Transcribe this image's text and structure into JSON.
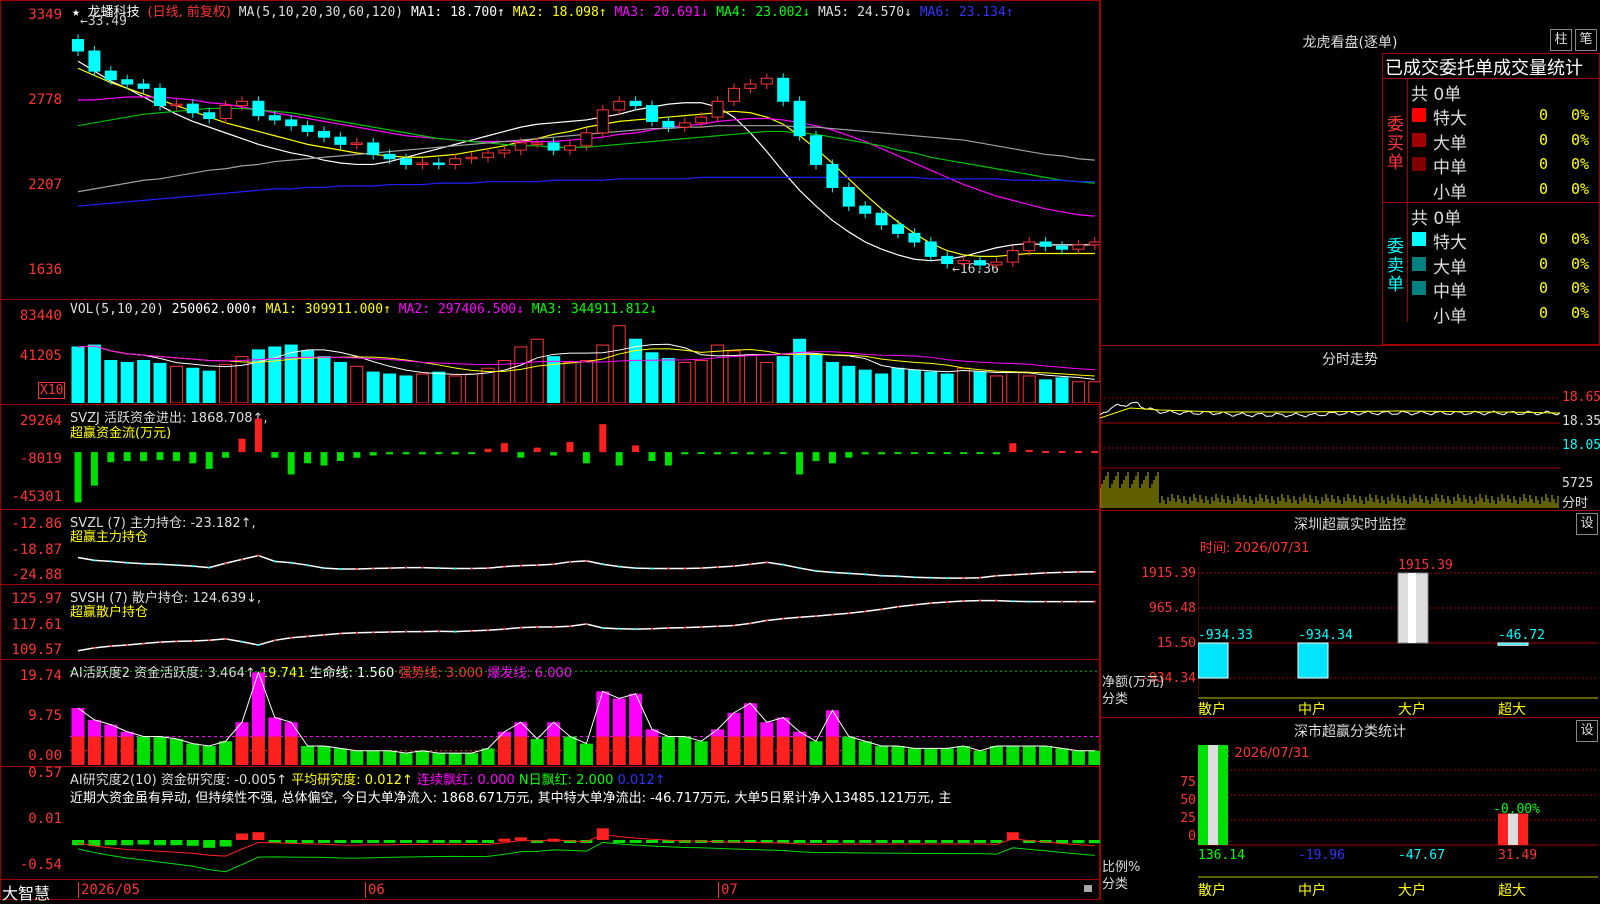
{
  "chart_data": [
    {
      "type": "candlestick",
      "title": "龙蟠科技",
      "period_label": "(日线, 前复权)",
      "ma_label": "MA(5,10,20,30,60,120)",
      "ma_values": [
        "MA1: 18.700↑",
        "MA2: 18.098↑",
        "MA3: 20.691↓",
        "MA4: 23.002↓",
        "MA5: 24.570↓",
        "MA6: 23.134↑"
      ],
      "yticks": [
        "3349",
        "2778",
        "2207",
        "1636"
      ],
      "annotations": [
        "←33.49",
        "←16.36"
      ],
      "close": [
        32.2,
        30.8,
        30.2,
        29.9,
        29.6,
        28.4,
        28.5,
        27.9,
        27.5,
        28.4,
        28.7,
        27.7,
        27.4,
        27.0,
        26.6,
        26.2,
        25.7,
        25.8,
        25.0,
        24.7,
        24.3,
        24.4,
        24.3,
        24.7,
        24.8,
        25.1,
        25.3,
        25.8,
        25.8,
        25.3,
        25.6,
        26.5,
        28.1,
        28.7,
        28.4,
        27.3,
        26.9,
        27.2,
        27.6,
        28.7,
        29.6,
        29.9,
        30.3,
        28.7,
        26.3,
        24.3,
        22.7,
        21.4,
        20.9,
        20.1,
        19.5,
        18.9,
        17.9,
        17.4,
        17.6,
        17.3,
        17.5,
        18.3,
        18.9,
        18.6,
        18.4,
        18.7,
        18.9
      ],
      "ma_lines": {
        "MA1": [
          31.5,
          30.8,
          30.1,
          29.6,
          29.0,
          28.4,
          27.8,
          27.3,
          26.9,
          26.5,
          26.1,
          25.7,
          25.4,
          25.1,
          24.9,
          24.6,
          24.4,
          24.3,
          24.3,
          24.5,
          24.8,
          25.1,
          25.4,
          25.7,
          26.0,
          26.3,
          26.6,
          26.9,
          27.1,
          27.2,
          27.3,
          27.4,
          27.6,
          27.8,
          28.1,
          28.3,
          28.5,
          28.6,
          28.6,
          28.3,
          27.6,
          26.5,
          25.2,
          23.8,
          22.5,
          21.4,
          20.4,
          19.6,
          18.9,
          18.4,
          18.0,
          17.7,
          17.6,
          17.7,
          17.9,
          18.2,
          18.5,
          18.7,
          18.8,
          18.7,
          18.7,
          18.7,
          18.7
        ],
        "MA2": [
          31.0,
          30.5,
          30.0,
          29.6,
          29.2,
          28.8,
          28.4,
          28.0,
          27.6,
          27.2,
          26.9,
          26.6,
          26.3,
          26.0,
          25.7,
          25.5,
          25.3,
          25.1,
          25.0,
          24.9,
          24.8,
          24.8,
          24.9,
          25.0,
          25.2,
          25.4,
          25.6,
          25.9,
          26.1,
          26.4,
          26.6,
          26.9,
          27.1,
          27.3,
          27.4,
          27.5,
          27.6,
          27.7,
          27.8,
          27.9,
          28.0,
          27.9,
          27.6,
          27.1,
          26.3,
          25.4,
          24.4,
          23.3,
          22.2,
          21.2,
          20.3,
          19.5,
          18.8,
          18.3,
          18.0,
          17.9,
          17.9,
          18.0,
          18.1,
          18.1,
          18.1,
          18.1,
          18.1
        ],
        "MA3": [
          28.8,
          28.8,
          28.9,
          29.0,
          29.0,
          29.0,
          28.9,
          28.8,
          28.6,
          28.5,
          28.3,
          28.1,
          27.9,
          27.7,
          27.5,
          27.3,
          27.1,
          26.9,
          26.7,
          26.5,
          26.3,
          26.2,
          26.1,
          26.0,
          25.9,
          25.9,
          25.9,
          25.9,
          25.9,
          25.9,
          26.0,
          26.1,
          26.2,
          26.4,
          26.5,
          26.7,
          26.9,
          27.0,
          27.1,
          27.3,
          27.4,
          27.5,
          27.5,
          27.4,
          27.2,
          27.0,
          26.7,
          26.3,
          25.9,
          25.4,
          24.9,
          24.4,
          23.9,
          23.4,
          22.9,
          22.5,
          22.1,
          21.8,
          21.5,
          21.2,
          21.0,
          20.8,
          20.7
        ],
        "MA4": [
          27.0,
          27.2,
          27.4,
          27.6,
          27.8,
          27.9,
          28.0,
          28.1,
          28.2,
          28.2,
          28.2,
          28.1,
          28.0,
          27.9,
          27.7,
          27.5,
          27.3,
          27.1,
          26.9,
          26.7,
          26.5,
          26.3,
          26.1,
          26.0,
          25.9,
          25.8,
          25.7,
          25.6,
          25.6,
          25.5,
          25.5,
          25.5,
          25.6,
          25.7,
          25.8,
          25.9,
          26.0,
          26.1,
          26.2,
          26.3,
          26.4,
          26.5,
          26.6,
          26.6,
          26.5,
          26.4,
          26.2,
          26.0,
          25.8,
          25.6,
          25.3,
          25.1,
          24.8,
          24.6,
          24.4,
          24.2,
          24.0,
          23.8,
          23.6,
          23.4,
          23.2,
          23.1,
          23.0
        ],
        "MA5": [
          22.4,
          22.6,
          22.8,
          23.0,
          23.2,
          23.3,
          23.5,
          23.7,
          23.9,
          24.0,
          24.2,
          24.3,
          24.5,
          24.6,
          24.7,
          24.8,
          24.9,
          25.0,
          25.1,
          25.2,
          25.3,
          25.4,
          25.5,
          25.6,
          25.7,
          25.8,
          25.9,
          26.0,
          26.1,
          26.2,
          26.3,
          26.4,
          26.5,
          26.6,
          26.7,
          26.8,
          26.8,
          26.9,
          26.9,
          27.0,
          27.0,
          27.0,
          27.0,
          27.0,
          26.9,
          26.9,
          26.8,
          26.7,
          26.6,
          26.5,
          26.4,
          26.3,
          26.2,
          26.1,
          26.0,
          25.8,
          25.6,
          25.4,
          25.2,
          25.0,
          24.9,
          24.7,
          24.6
        ],
        "MA6": [
          21.4,
          21.5,
          21.6,
          21.7,
          21.8,
          21.9,
          22.0,
          22.1,
          22.2,
          22.3,
          22.4,
          22.5,
          22.6,
          22.6,
          22.7,
          22.7,
          22.8,
          22.8,
          22.8,
          22.9,
          22.9,
          22.9,
          23.0,
          23.0,
          23.0,
          23.1,
          23.1,
          23.1,
          23.1,
          23.2,
          23.2,
          23.2,
          23.2,
          23.3,
          23.3,
          23.3,
          23.3,
          23.3,
          23.4,
          23.4,
          23.4,
          23.4,
          23.4,
          23.4,
          23.4,
          23.4,
          23.4,
          23.4,
          23.4,
          23.4,
          23.4,
          23.4,
          23.3,
          23.3,
          23.3,
          23.3,
          23.3,
          23.2,
          23.2,
          23.2,
          23.2,
          23.1,
          23.1
        ]
      },
      "ylim": [
        15.0,
        34.5
      ],
      "x_labels": [
        "2026/05",
        "06",
        "07"
      ]
    },
    {
      "type": "bar",
      "title": "VOL(5,10,20)",
      "values_text": [
        "250062.000↑",
        "MA1: 309911.000↑",
        "MA2: 297406.500↓",
        "MA3: 344911.812↓"
      ],
      "yticks": [
        "83440",
        "41205"
      ],
      "unit": "X10",
      "values": [
        58,
        60,
        44,
        42,
        44,
        41,
        38,
        36,
        33,
        40,
        48,
        55,
        58,
        60,
        54,
        48,
        42,
        38,
        32,
        30,
        28,
        30,
        32,
        28,
        30,
        36,
        44,
        58,
        66,
        48,
        42,
        44,
        60,
        80,
        66,
        52,
        46,
        42,
        44,
        60,
        54,
        50,
        42,
        48,
        66,
        50,
        42,
        38,
        34,
        30,
        36,
        34,
        32,
        30,
        36,
        32,
        28,
        32,
        28,
        24,
        26,
        22,
        22
      ],
      "ylim": [
        0,
        88
      ]
    },
    {
      "type": "bar",
      "title": "SVZJ 活跃资金进出: 1868.708↑,",
      "subtitle": "超赢资金流(万元)",
      "yticks": [
        "29264",
        "-8019",
        "-45301"
      ],
      "values": [
        -45,
        -30,
        -9,
        -8,
        -8,
        -7,
        -8,
        -10,
        -15,
        -5,
        12,
        30,
        -5,
        -20,
        -10,
        -12,
        -8,
        -5,
        -3,
        -2,
        -2,
        -2,
        -1,
        -2,
        -1,
        3,
        8,
        -5,
        4,
        -3,
        9,
        -10,
        25,
        -12,
        6,
        -8,
        -12,
        -2,
        -1,
        -2,
        -1,
        -2,
        -2,
        -1,
        -20,
        -8,
        -10,
        -5,
        -2,
        -2,
        -1,
        -1,
        -1,
        -1,
        -1,
        -1,
        -2,
        8,
        2,
        1,
        1,
        1,
        1
      ],
      "ylim": [
        -50,
        35
      ]
    },
    {
      "type": "line",
      "title": "SVZL (7) 主力持仓: -23.182↑,",
      "subtitle": "超赢主力持仓",
      "yticks": [
        "-12.86",
        "-18.87",
        "-24.88"
      ],
      "values": [
        -20.2,
        -20.8,
        -21.0,
        -21.3,
        -21.5,
        -21.6,
        -21.8,
        -22.0,
        -22.3,
        -21.4,
        -20.6,
        -19.8,
        -21.0,
        -21.3,
        -21.8,
        -22.4,
        -22.6,
        -22.6,
        -22.5,
        -22.4,
        -22.3,
        -22.3,
        -22.4,
        -22.5,
        -22.5,
        -22.4,
        -22.1,
        -21.9,
        -21.8,
        -21.6,
        -21.1,
        -20.9,
        -21.6,
        -22.1,
        -22.4,
        -22.5,
        -22.5,
        -22.5,
        -22.4,
        -22.2,
        -22.0,
        -21.6,
        -21.2,
        -21.7,
        -22.4,
        -23.0,
        -23.3,
        -23.5,
        -23.7,
        -24.0,
        -24.1,
        -24.3,
        -24.4,
        -24.5,
        -24.5,
        -24.4,
        -24.0,
        -23.8,
        -23.6,
        -23.4,
        -23.3,
        -23.2,
        -23.2
      ],
      "ylim": [
        -25.5,
        -12.0
      ]
    },
    {
      "type": "line",
      "title": "SVSH (7) 散户持仓: 124.639↓,",
      "subtitle": "超赢散户持仓",
      "yticks": [
        "125.97",
        "117.61",
        "109.57"
      ],
      "values": [
        111.0,
        111.8,
        112.3,
        112.6,
        113.0,
        113.4,
        113.6,
        113.7,
        113.9,
        114.3,
        113.5,
        112.6,
        113.9,
        114.6,
        115.0,
        115.4,
        115.8,
        116.0,
        116.1,
        116.2,
        116.3,
        116.3,
        116.4,
        116.3,
        116.5,
        116.7,
        117.0,
        117.4,
        117.6,
        117.6,
        117.8,
        118.4,
        117.3,
        117.1,
        117.0,
        117.1,
        117.3,
        117.4,
        117.6,
        117.8,
        118.0,
        118.6,
        119.4,
        119.9,
        120.3,
        120.6,
        121.0,
        121.4,
        121.9,
        122.5,
        123.2,
        123.7,
        124.2,
        124.5,
        124.8,
        124.9,
        124.9,
        124.7,
        124.6,
        124.6,
        124.6,
        124.6,
        124.6
      ],
      "ylim": [
        109.0,
        127.0
      ]
    },
    {
      "type": "bar",
      "title": "AI活跃度2 资金活跃度: 3.464↑",
      "values_text": [
        "19.741",
        "生命线: 1.560",
        "强势线: 3.000",
        "爆发线: 6.000"
      ],
      "yticks": [
        "19.74",
        "9.75",
        "0.00"
      ],
      "values": [
        12,
        9.5,
        8.5,
        7,
        6,
        6,
        5.5,
        4.5,
        4,
        5,
        9,
        19.5,
        10,
        9,
        4,
        4,
        3.5,
        3,
        3,
        3,
        2.5,
        3,
        2.5,
        2.5,
        2.5,
        3.5,
        7,
        9,
        5.5,
        9,
        6,
        4.5,
        15.5,
        14,
        15,
        7.5,
        6,
        6,
        5,
        7.5,
        11,
        13,
        9,
        10,
        7,
        5,
        11.5,
        6,
        5,
        4,
        4,
        3.5,
        3.5,
        3.5,
        4,
        3,
        4,
        4,
        4,
        4,
        3.5,
        3,
        3
      ],
      "ylim": [
        0,
        20
      ]
    },
    {
      "type": "bar",
      "title": "AI研究度2(10) 资金研究度: -0.005↑",
      "values_text": [
        "平均研究度: 0.012↑",
        "连续飘红: 0.000",
        "N日飘红: 2.000",
        "0.012↑"
      ],
      "comment": "近期大资金虽有异动, 但持续性不强, 总体偏空, 今日大单净流入: 1868.671万元, 其中特大单净流出: -46.717万元, 大单5日累计净入13485.121万元, 主",
      "yticks": [
        "0.57",
        "0.01",
        "-0.54"
      ],
      "values": [
        -0.08,
        -0.09,
        -0.08,
        -0.08,
        -0.07,
        -0.08,
        -0.08,
        -0.09,
        -0.12,
        -0.1,
        0.1,
        0.12,
        -0.02,
        -0.03,
        -0.03,
        -0.03,
        -0.04,
        -0.03,
        -0.02,
        -0.02,
        -0.02,
        -0.02,
        -0.02,
        -0.02,
        -0.03,
        -0.02,
        0.02,
        0.04,
        -0.01,
        0.02,
        -0.02,
        -0.03,
        0.18,
        -0.03,
        -0.02,
        -0.02,
        -0.02,
        -0.02,
        -0.01,
        -0.02,
        -0.02,
        -0.02,
        -0.02,
        -0.02,
        -0.04,
        -0.03,
        -0.02,
        -0.02,
        -0.02,
        -0.02,
        -0.02,
        -0.02,
        -0.02,
        -0.02,
        -0.02,
        -0.02,
        -0.03,
        0.12,
        -0.04,
        -0.04,
        -0.05,
        -0.05,
        -0.05
      ],
      "ylim": [
        -0.6,
        0.6
      ]
    }
  ],
  "footer": {
    "brand": "大智慧"
  },
  "right_panel": {
    "dragon_tiger": {
      "title": "龙虎看盘(逐单)",
      "btn_zhu": "柱",
      "btn_bi": "笔",
      "subtitle": "已成交委托单成交量统计",
      "buy_label": "委买单",
      "sell_label": "委卖单",
      "buy_total": "共 0单",
      "sell_total": "共 0单",
      "buy_rows": [
        {
          "label": "特大",
          "count": "0",
          "pct": "0%",
          "color": "#ff0000"
        },
        {
          "label": "大单",
          "count": "0",
          "pct": "0%",
          "color": "#a00000"
        },
        {
          "label": "中单",
          "count": "0",
          "pct": "0%",
          "color": "#800000"
        },
        {
          "label": "小单",
          "count": "0",
          "pct": "0%",
          "color": ""
        }
      ],
      "sell_rows": [
        {
          "label": "特大",
          "count": "0",
          "pct": "0%",
          "color": "#00ffff"
        },
        {
          "label": "大单",
          "count": "0",
          "pct": "0%",
          "color": "#008080"
        },
        {
          "label": "中单",
          "count": "0",
          "pct": "0%",
          "color": "#008080"
        },
        {
          "label": "小单",
          "count": "0",
          "pct": "0%",
          "color": ""
        }
      ]
    },
    "intraday": {
      "title": "分时走势",
      "price_labels": [
        "18.65",
        "18.35",
        "18.05"
      ],
      "vol_label": "5725",
      "vol_unit": "分时"
    },
    "sz_monitor": {
      "title": "深圳超赢实时监控",
      "btn": "设",
      "time": "时间: 2026/07/31",
      "yticks": [
        "1915.39",
        "965.48",
        "15.50",
        "-934.34"
      ],
      "ylabel": "净额(万元)",
      "xlabel": "分类",
      "categories": [
        "散户",
        "中户",
        "大户",
        "超大"
      ],
      "values": [
        -934.34,
        -934.34,
        1915.39,
        -46.72
      ],
      "value_labels": [
        "-934.33",
        "-934.34",
        "1915.39",
        "-46.72"
      ]
    },
    "sz_class": {
      "title": "深市超赢分类统计",
      "btn": "设",
      "time": "时间: 2026/07/31",
      "yticks": [
        "75",
        "50",
        "25",
        "0"
      ],
      "ylabel": "比例%",
      "xlabel": "分类",
      "categories": [
        "散户",
        "中户",
        "大户",
        "超大"
      ],
      "values": [
        136.14,
        -19.96,
        -47.67,
        31.49
      ],
      "value_labels": [
        "136.14",
        "-19.96",
        "-47.67",
        "31.49"
      ],
      "extra_label": "-0.00%"
    }
  }
}
